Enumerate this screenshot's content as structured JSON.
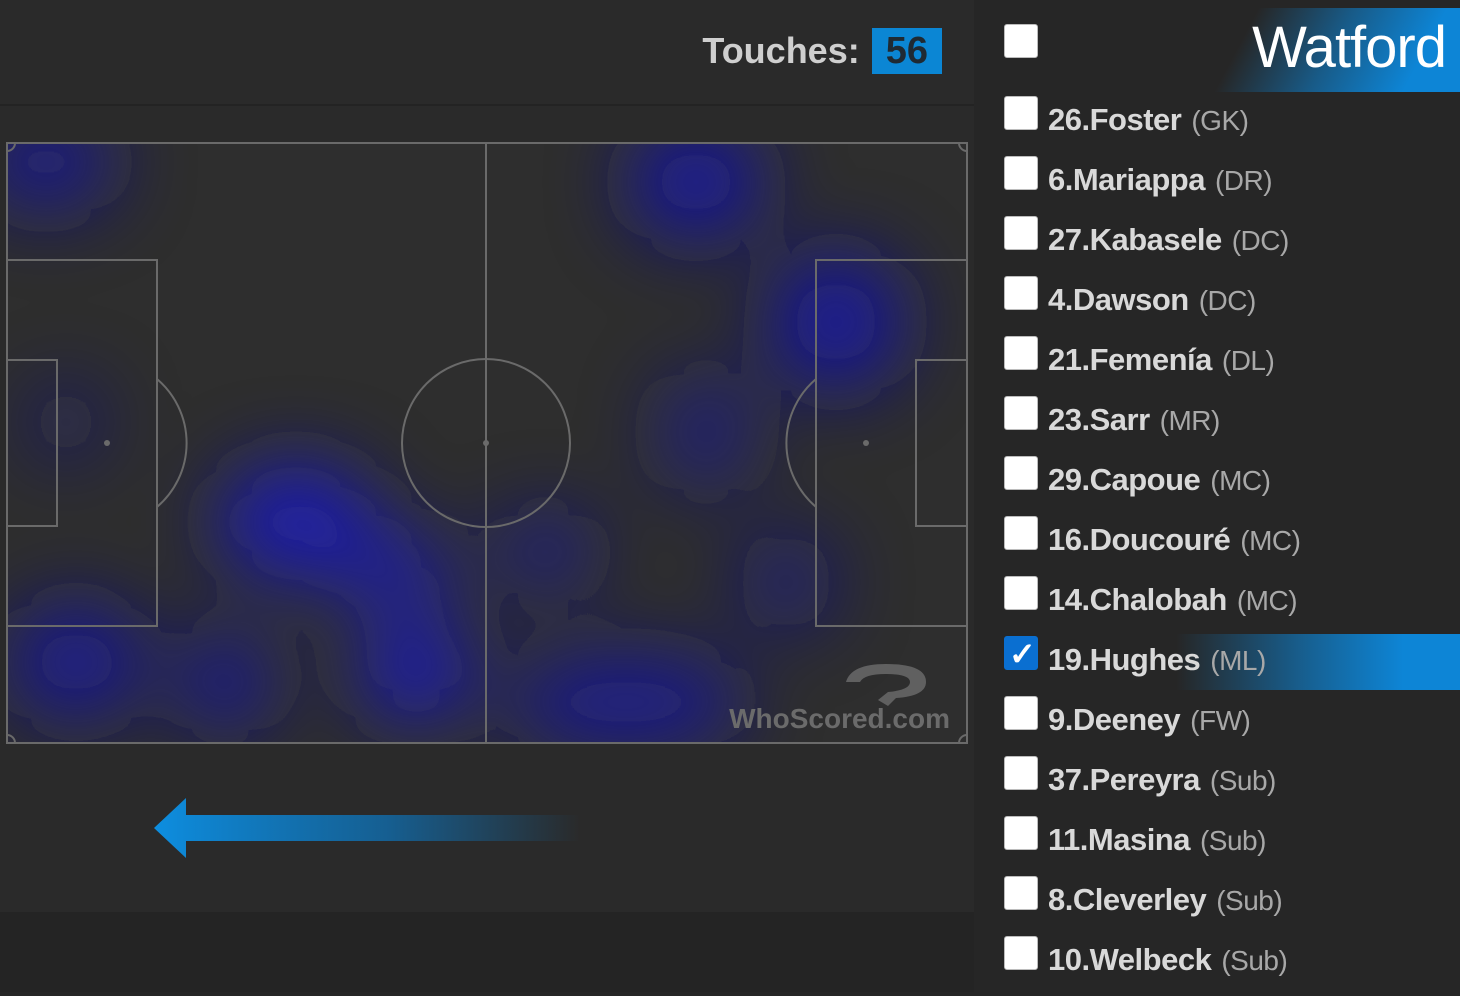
{
  "header": {
    "touches_label": "Touches:",
    "touches_value": "56"
  },
  "pitch": {
    "watermark": "WhoScored.com",
    "attack_direction": "left",
    "heat_color": "#1a1aa8",
    "line_color": "#6a6a6a"
  },
  "team": {
    "name": "Watford",
    "accent": "#0d85d6",
    "select_all_checked": false
  },
  "players": [
    {
      "name": "26.Foster",
      "pos": "(GK)",
      "checked": false
    },
    {
      "name": "6.Mariappa",
      "pos": "(DR)",
      "checked": false
    },
    {
      "name": "27.Kabasele",
      "pos": "(DC)",
      "checked": false
    },
    {
      "name": "4.Dawson",
      "pos": "(DC)",
      "checked": false
    },
    {
      "name": "21.Femenía",
      "pos": "(DL)",
      "checked": false
    },
    {
      "name": "23.Sarr",
      "pos": "(MR)",
      "checked": false
    },
    {
      "name": "29.Capoue",
      "pos": "(MC)",
      "checked": false
    },
    {
      "name": "16.Doucouré",
      "pos": "(MC)",
      "checked": false
    },
    {
      "name": "14.Chalobah",
      "pos": "(MC)",
      "checked": false
    },
    {
      "name": "19.Hughes",
      "pos": "(ML)",
      "checked": true
    },
    {
      "name": "9.Deeney",
      "pos": "(FW)",
      "checked": false
    },
    {
      "name": "37.Pereyra",
      "pos": "(Sub)",
      "checked": false
    },
    {
      "name": "11.Masina",
      "pos": "(Sub)",
      "checked": false
    },
    {
      "name": "8.Cleverley",
      "pos": "(Sub)",
      "checked": false
    },
    {
      "name": "10.Welbeck",
      "pos": "(Sub)",
      "checked": false
    }
  ]
}
